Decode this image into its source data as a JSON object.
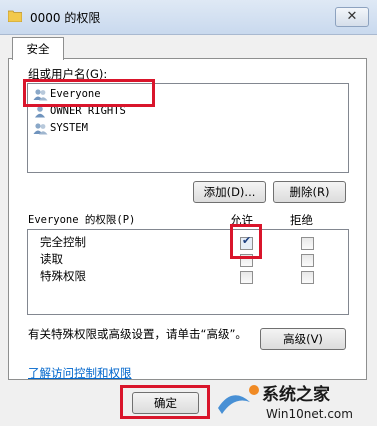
{
  "window": {
    "title": "0000 的权限",
    "close": "✕"
  },
  "tabs": [
    {
      "label": "安全"
    }
  ],
  "group_label": "组或用户名(G):",
  "users": [
    {
      "name": "Everyone"
    },
    {
      "name": "OWNER RIGHTS"
    },
    {
      "name": "SYSTEM"
    }
  ],
  "buttons": {
    "add": "添加(D)...",
    "remove": "删除(R)",
    "advanced": "高级(V)",
    "ok": "确定"
  },
  "permissions": {
    "title": "Everyone 的权限(P)",
    "allow_header": "允许",
    "deny_header": "拒绝",
    "rows": [
      {
        "label": "完全控制",
        "allow": true,
        "deny": false
      },
      {
        "label": "读取",
        "allow": false,
        "deny": false
      },
      {
        "label": "特殊权限",
        "allow": false,
        "deny": false
      }
    ]
  },
  "advanced_text": "有关特殊权限或高级设置，请单击“高级”。",
  "learn_link": "了解访问控制和权限",
  "watermark": {
    "brand": "系统之家",
    "url": "Win10net.com"
  },
  "colors": {
    "highlight": "#d9152b",
    "link": "#0066cc",
    "title_bar": "#c9d9ee"
  }
}
